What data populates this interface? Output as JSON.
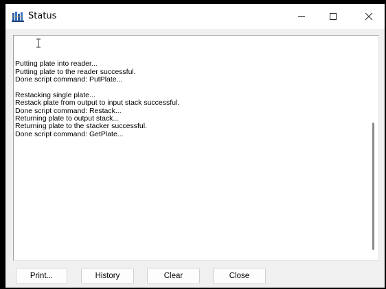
{
  "window": {
    "title": "Status",
    "icon": "status-app-icon",
    "controls": [
      "minimize",
      "maximize",
      "close"
    ]
  },
  "log": {
    "lines": [
      "",
      "",
      "",
      "Putting plate into reader...",
      "Putting plate to the reader successful.",
      "Done script command: PutPlate...",
      "",
      "Restacking single plate...",
      "Restack plate from output to input stack successful.",
      "Done script command: Restack...",
      "Returning plate to output stack...",
      "Returning plate to the stacker successful.",
      "Done script command: GetPlate..."
    ]
  },
  "buttons": {
    "print": "Print...",
    "history": "History",
    "clear": "Clear",
    "close": "Close"
  }
}
